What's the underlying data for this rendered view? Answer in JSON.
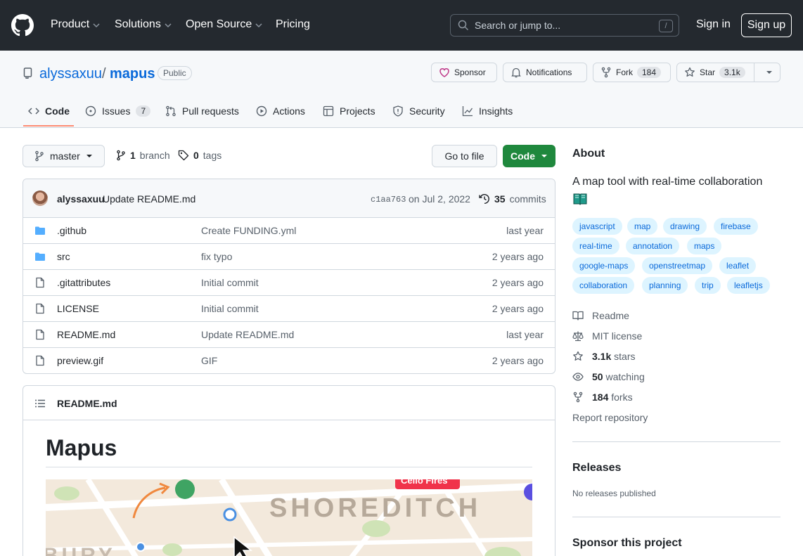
{
  "header": {
    "nav": [
      "Product",
      "Solutions",
      "Open Source",
      "Pricing"
    ],
    "search_placeholder": "Search or jump to...",
    "search_shortcut": "/",
    "signin": "Sign in",
    "signup": "Sign up"
  },
  "repo": {
    "owner": "alyssaxuu",
    "sep": "/",
    "name": "mapus",
    "visibility": "Public",
    "sponsor": "Sponsor",
    "notifications": "Notifications",
    "fork": "Fork",
    "fork_count": "184",
    "star": "Star",
    "star_count": "3.1k"
  },
  "tabs": [
    {
      "label": "Code"
    },
    {
      "label": "Issues",
      "count": "7"
    },
    {
      "label": "Pull requests"
    },
    {
      "label": "Actions"
    },
    {
      "label": "Projects"
    },
    {
      "label": "Security"
    },
    {
      "label": "Insights"
    }
  ],
  "toolbar": {
    "branch": "master",
    "branch_count": "1",
    "branch_word": "branch",
    "tag_count": "0",
    "tag_word": "tags",
    "goto_file": "Go to file",
    "code": "Code"
  },
  "commit": {
    "author": "alyssaxuu",
    "message": "Update README.md",
    "hash": "c1aa763",
    "date": "on Jul 2, 2022",
    "count": "35",
    "count_word": "commits"
  },
  "files": [
    {
      "name": ".github",
      "type": "dir",
      "message": "Create FUNDING.yml",
      "age": "last year"
    },
    {
      "name": "src",
      "type": "dir",
      "message": "fix typo",
      "age": "2 years ago"
    },
    {
      "name": ".gitattributes",
      "type": "file",
      "message": "Initial commit",
      "age": "2 years ago"
    },
    {
      "name": "LICENSE",
      "type": "file",
      "message": "Initial commit",
      "age": "2 years ago"
    },
    {
      "name": "README.md",
      "type": "file",
      "message": "Update README.md",
      "age": "last year"
    },
    {
      "name": "preview.gif",
      "type": "file",
      "message": "GIF",
      "age": "2 years ago"
    }
  ],
  "readme": {
    "filename": "README.md",
    "title": "Mapus",
    "map_label": "SHOREDITCH",
    "map_badge": "Cello Fires",
    "map_fragment": "BURY"
  },
  "about": {
    "heading": "About",
    "description": "A map tool with real-time collaboration",
    "topics": [
      "javascript",
      "map",
      "drawing",
      "firebase",
      "real-time",
      "annotation",
      "maps",
      "google-maps",
      "openstreetmap",
      "leaflet",
      "collaboration",
      "planning",
      "trip",
      "leafletjs"
    ],
    "readme": "Readme",
    "license": "MIT license",
    "stars_count": "3.1k",
    "stars_word": "stars",
    "watching_count": "50",
    "watching_word": "watching",
    "forks_count": "184",
    "forks_word": "forks",
    "report": "Report repository"
  },
  "releases": {
    "heading": "Releases",
    "empty": "No releases published"
  },
  "sponsor": {
    "heading": "Sponsor this project"
  },
  "colors": {
    "header_bg": "#24292f",
    "accent": "#0969da",
    "primary_button": "#1f883d",
    "tab_underline": "#fd8c73"
  }
}
